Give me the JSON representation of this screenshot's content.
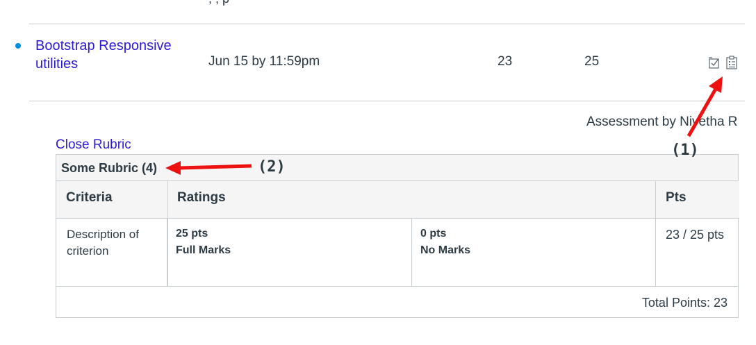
{
  "top_partial_text": ", ,  p",
  "assignment": {
    "title": "Bootstrap Responsive utilities",
    "due": "Jun 15 by 11:59pm",
    "score": "23",
    "points_possible": "25",
    "icons": [
      "rubric-assess-icon",
      "rubric-clipboard-icon"
    ]
  },
  "assessment_by": "Assessment by Nivetha R",
  "close_rubric": "Close Rubric",
  "rubric": {
    "title": "Some Rubric (4)",
    "headers": {
      "criteria": "Criteria",
      "ratings": "Ratings",
      "pts": "Pts"
    },
    "criterion": {
      "description": "Description of criterion",
      "ratings": [
        {
          "points": "25 pts",
          "label": "Full Marks"
        },
        {
          "points": "0 pts",
          "label": "No Marks"
        }
      ],
      "score": "23 / 25 pts"
    },
    "total": "Total Points: 23"
  },
  "annotations": {
    "one": "(1)",
    "two": "(2)"
  },
  "colors": {
    "link": "#2b1bd6",
    "bullet": "#008ee2",
    "arrow": "#ee1111"
  }
}
